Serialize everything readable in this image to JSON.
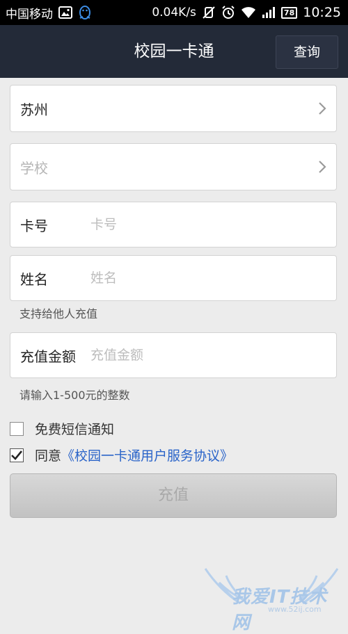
{
  "status_bar": {
    "carrier": "中国移动",
    "network_speed": "0.04K/s",
    "battery": "78",
    "time": "10:25"
  },
  "header": {
    "title": "校园一卡通",
    "query_label": "查询"
  },
  "form": {
    "city": "苏州",
    "school_placeholder": "学校",
    "card_label": "卡号",
    "card_placeholder": "卡号",
    "name_label": "姓名",
    "name_placeholder": "姓名",
    "name_hint": "支持给他人充值",
    "amount_label": "充值金额",
    "amount_placeholder": "充值金额",
    "amount_hint": "请输入1-500元的整数"
  },
  "options": {
    "sms_label": "免费短信通知",
    "sms_checked": false,
    "agree_prefix": "同意",
    "agree_link": "《校园一卡通用户服务协议》",
    "agree_checked": true
  },
  "submit_label": "充值",
  "watermark": {
    "text": "我爱IT技术网",
    "url": "www.52ij.com"
  }
}
